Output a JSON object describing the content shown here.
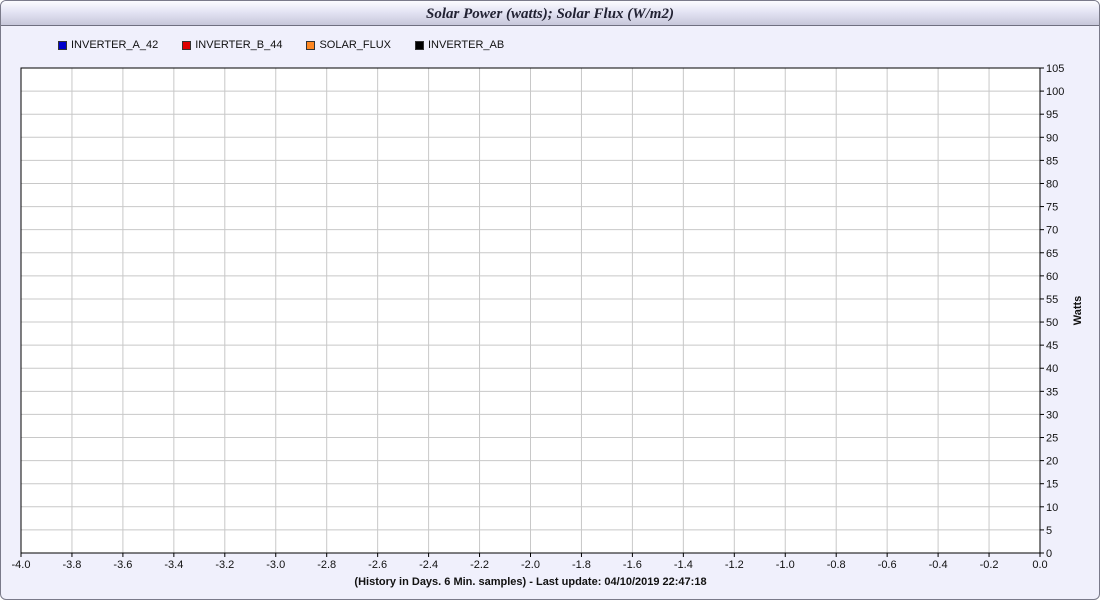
{
  "chart_title": "Solar Power (watts); Solar Flux (W/m2)",
  "colors": {
    "frame_bg": "#f0f0fc",
    "plot_bg": "#ffffff",
    "grid": "#c8c8c8"
  },
  "chart_data": {
    "type": "line",
    "title": "Solar Power (watts); Solar Flux (W/m2)",
    "xlabel": "(History in Days. 6 Min. samples) - Last update: 04/10/2019 22:47:18",
    "ylabel": "Watts",
    "xlim": [
      -4.0,
      0.0
    ],
    "ylim": [
      0,
      105
    ],
    "x_ticks": [
      "-4.0",
      "-3.8",
      "-3.6",
      "-3.4",
      "-3.2",
      "-3.0",
      "-2.8",
      "-2.6",
      "-2.4",
      "-2.2",
      "-2.0",
      "-1.8",
      "-1.6",
      "-1.4",
      "-1.2",
      "-1.0",
      "-0.8",
      "-0.6",
      "-0.4",
      "-0.2",
      "0.0"
    ],
    "y_ticks": [
      "0",
      "5",
      "10",
      "15",
      "20",
      "25",
      "30",
      "35",
      "40",
      "45",
      "50",
      "55",
      "60",
      "65",
      "70",
      "75",
      "80",
      "85",
      "90",
      "95",
      "100",
      "105"
    ],
    "y_axis_side": "right",
    "grid": true,
    "legend_position": "top-left",
    "series": [
      {
        "name": "INVERTER_A_42",
        "color": "#0000cc",
        "values": []
      },
      {
        "name": "INVERTER_B_44",
        "color": "#dd0000",
        "values": []
      },
      {
        "name": "SOLAR_FLUX",
        "color": "#ff8822",
        "values": []
      },
      {
        "name": "INVERTER_AB",
        "color": "#000000",
        "values": []
      }
    ]
  }
}
